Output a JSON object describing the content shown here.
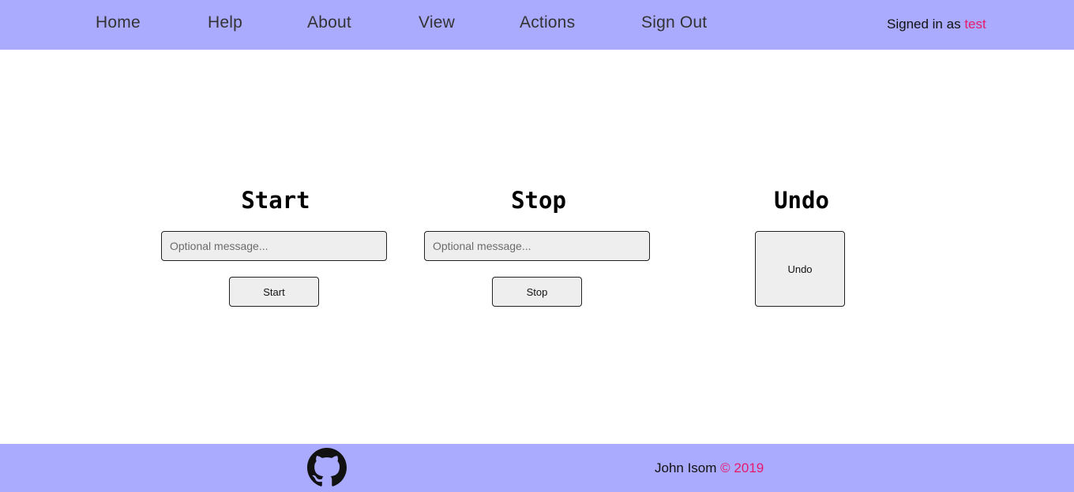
{
  "nav": {
    "items": [
      {
        "label": "Home"
      },
      {
        "label": "Help"
      },
      {
        "label": "About"
      },
      {
        "label": "View"
      },
      {
        "label": "Actions"
      },
      {
        "label": "Sign Out"
      }
    ],
    "signed_in_prefix": "Signed in as",
    "username": "test"
  },
  "main": {
    "start": {
      "title": "Start",
      "placeholder": "Optional message...",
      "value": "",
      "button_label": "Start"
    },
    "stop": {
      "title": "Stop",
      "placeholder": "Optional message...",
      "value": "",
      "button_label": "Stop"
    },
    "undo": {
      "title": "Undo",
      "button_label": "Undo"
    }
  },
  "footer": {
    "github_icon": "github-icon",
    "author": "John Isom",
    "copyright": "© 2019"
  },
  "colors": {
    "bar": "#aaaafe",
    "accent": "#e8196a",
    "control_bg": "#eeeeee"
  }
}
